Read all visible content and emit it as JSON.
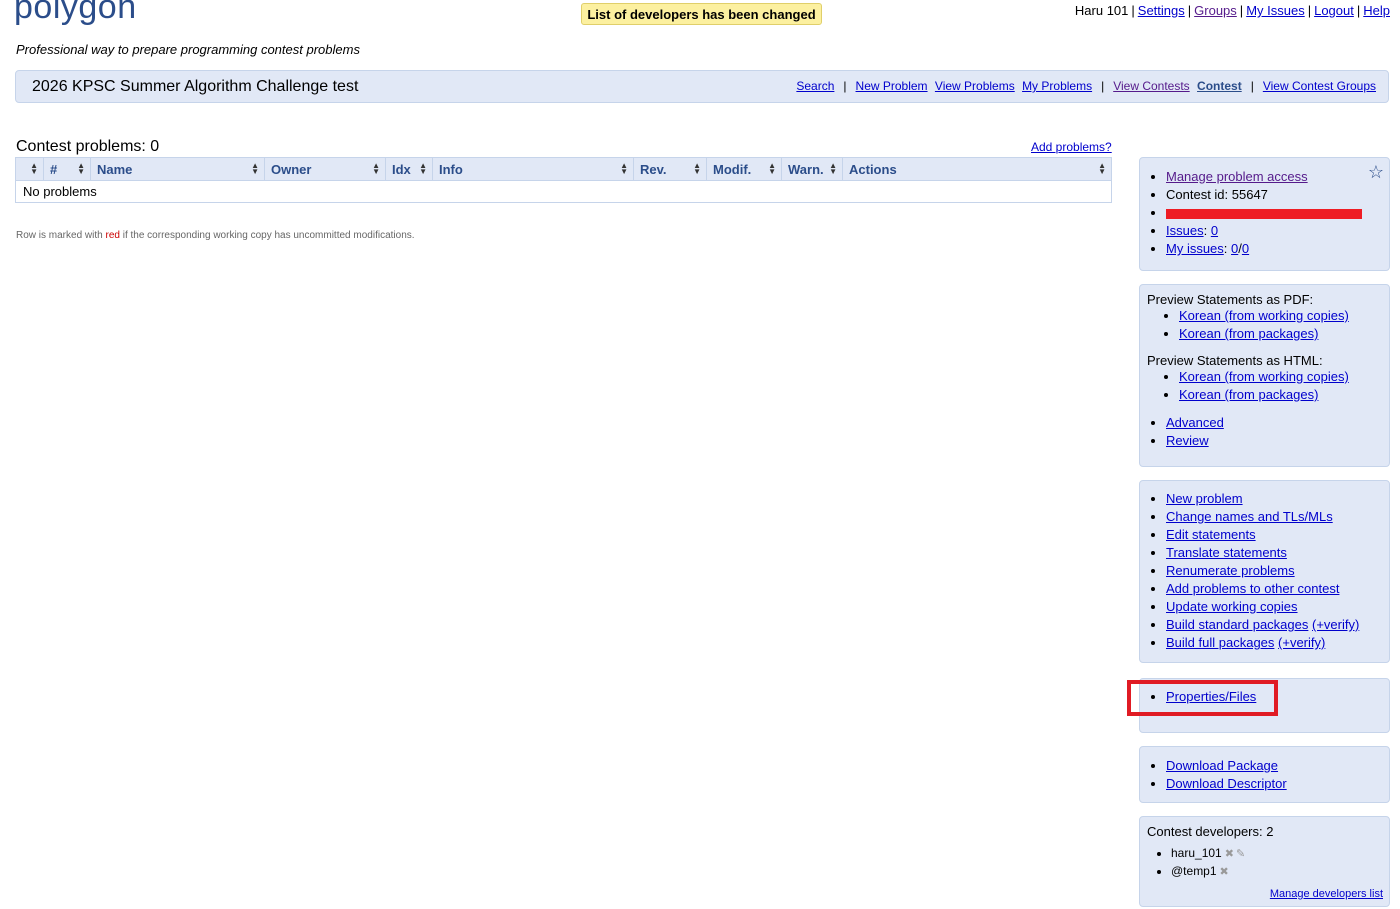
{
  "header": {
    "logo": "polygon",
    "tagline": "Professional way to prepare programming contest problems",
    "notice": "List of developers has been changed",
    "user": "Haru 101",
    "links": [
      "Settings",
      "Groups",
      "My Issues",
      "Logout",
      "Help"
    ]
  },
  "contest_bar": {
    "name": "2026 KPSC Summer Algorithm Challenge test",
    "nav": [
      "Search",
      "New Problem",
      "View Problems",
      "My Problems",
      "View Contests",
      "Contest",
      "View Contest Groups"
    ]
  },
  "problems": {
    "title": "Contest problems: 0",
    "add_link": "Add problems?",
    "columns": [
      "",
      "#",
      "Name",
      "Owner",
      "Idx",
      "Info",
      "Rev.",
      "Modif.",
      "Warn.",
      "Actions"
    ],
    "empty_text": "No problems",
    "note_prefix": "Row is marked with",
    "note_red": "red",
    "note_suffix": "if the corresponding working copy has uncommitted modifications."
  },
  "sidebar": {
    "box1": {
      "manage_access": "Manage problem access",
      "contest_id": "Contest id: 55647",
      "issues_label": "Issues",
      "issues_value": "0",
      "my_issues_label": "My issues",
      "my_issues_a": "0",
      "my_issues_sep": "/",
      "my_issues_b": "0"
    },
    "box2": {
      "pdf_heading": "Preview Statements as PDF:",
      "pdf_links": [
        "Korean (from working copies)",
        "Korean (from packages)"
      ],
      "html_heading": "Preview Statements as HTML:",
      "html_links": [
        "Korean (from working copies)",
        "Korean (from packages)"
      ],
      "advanced": "Advanced",
      "review": "Review"
    },
    "box3": {
      "items": [
        "New problem",
        "Change names and TLs/MLs",
        "Edit statements",
        "Translate statements",
        "Renumerate problems",
        "Add problems to other contest",
        "Update working copies"
      ],
      "build_standard": "Build standard packages",
      "build_full": "Build full packages",
      "verify": "(+verify)"
    },
    "box4": {
      "properties": "Properties/Files"
    },
    "box5": {
      "items": [
        "Download Package",
        "Download Descriptor"
      ]
    },
    "box6": {
      "heading": "Contest developers: 2",
      "developers": [
        "haru_101",
        "@temp1"
      ],
      "manage": "Manage developers list"
    }
  }
}
